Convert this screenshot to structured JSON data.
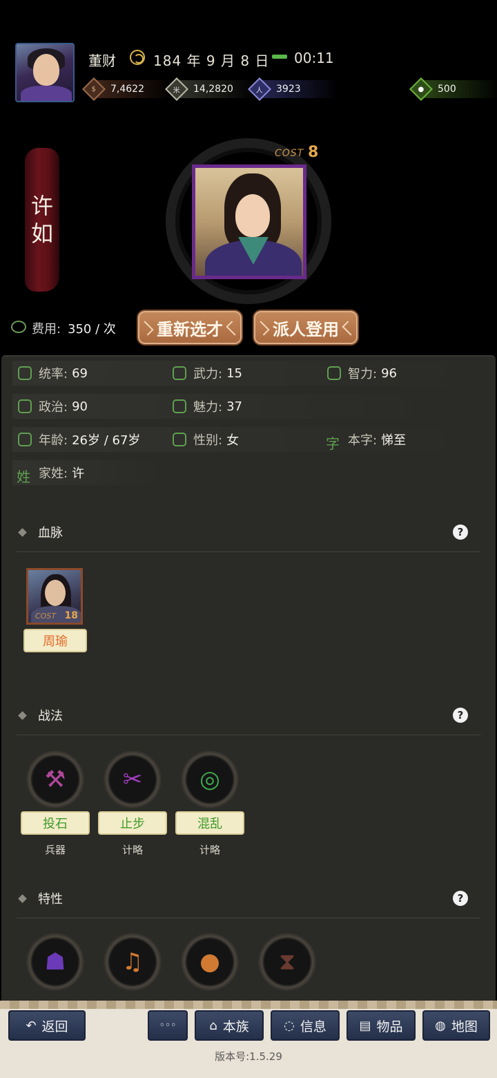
{
  "header": {
    "player_name": "董财",
    "date": "184 年 9 月 8 日",
    "time": "00:11",
    "resources": {
      "money": "7,4622",
      "food": "14,2820",
      "population": "3923",
      "gold": "500"
    }
  },
  "hero": {
    "name_char_1": "许",
    "name_char_2": "如",
    "cost_label": "COST",
    "cost_value": "8",
    "fee_label": "费用:",
    "fee_value": "350 / 次"
  },
  "actions": {
    "reselect": "重新选才",
    "recruit": "派人登用"
  },
  "stats": {
    "command": {
      "label": "统率:",
      "value": "69"
    },
    "force": {
      "label": "武力:",
      "value": "15"
    },
    "intellect": {
      "label": "智力:",
      "value": "96"
    },
    "politics": {
      "label": "政治:",
      "value": "90"
    },
    "charm": {
      "label": "魅力:",
      "value": "37"
    },
    "age": {
      "label": "年龄:",
      "value": "26岁 / 67岁"
    },
    "gender": {
      "label": "性别:",
      "value": "女"
    },
    "courtesy": {
      "icon": "字",
      "label": "本字:",
      "value": "悌至"
    },
    "family": {
      "icon": "姓",
      "label": "家姓:",
      "value": "许"
    }
  },
  "sections": {
    "lineage": "血脉",
    "tactics": "战法",
    "traits": "特性",
    "help": "?"
  },
  "lineage": {
    "name": "周瑜",
    "cost_label": "COST",
    "cost_value": "18"
  },
  "tactics": [
    {
      "name": "投石",
      "type": "兵器",
      "icon": "catapult-icon"
    },
    {
      "name": "止步",
      "type": "计略",
      "icon": "boot-icon"
    },
    {
      "name": "混乱",
      "type": "计略",
      "icon": "swirl-icon"
    }
  ],
  "traits": [
    {
      "icon": "mask-icon"
    },
    {
      "icon": "music-icon"
    },
    {
      "icon": "bag-icon"
    },
    {
      "icon": "shoes-icon"
    }
  ],
  "nav": {
    "back": "返回",
    "more": "◦◦◦",
    "clan": "本族",
    "info": "信息",
    "items": "物品",
    "map": "地图"
  },
  "version": "版本号:1.5.29",
  "colors": {
    "panel_bg": "#2a2a26",
    "accent_green": "#5fa050",
    "button_brown": "#a9683e",
    "nav_blue": "#2e3a56"
  }
}
